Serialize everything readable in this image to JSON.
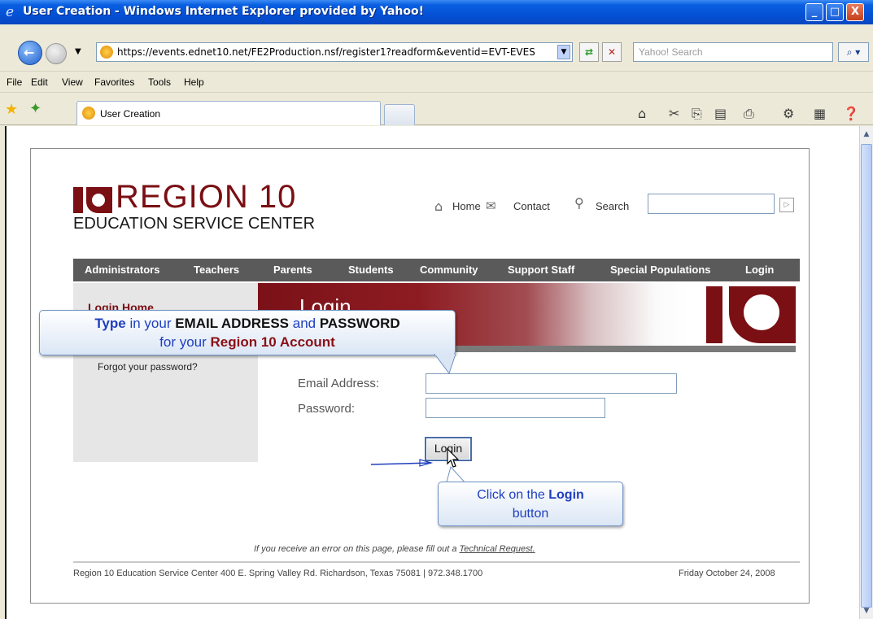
{
  "window": {
    "title": "User Creation - Windows Internet Explorer provided by Yahoo!",
    "minimize": "_",
    "maximize": "□",
    "close": "X"
  },
  "browser": {
    "url": "https://events.ednet10.net/FE2Production.nsf/register1?readform&eventid=EVT-EVES",
    "search_placeholder": "Yahoo! Search",
    "menu": [
      "File",
      "Edit",
      "View",
      "Favorites",
      "Tools",
      "Help"
    ],
    "tab_label": "User Creation",
    "icons": [
      "back-arrow-icon",
      "forward-arrow-icon",
      "refresh-icon",
      "stop-icon",
      "search-icon",
      "favorites-star-icon",
      "add-favorites-icon",
      "home-icon",
      "feeds-icon",
      "print-icon",
      "page-icon",
      "tools-icon",
      "help-icon"
    ]
  },
  "site": {
    "logo_text": "REGION 10",
    "logo_sub": "EDUCATION SERVICE CENTER",
    "top_links": {
      "home": "Home",
      "contact": "Contact",
      "search": "Search"
    },
    "nav": [
      "Administrators",
      "Teachers",
      "Parents",
      "Students",
      "Community",
      "Support Staff",
      "Special Populations",
      "Login"
    ],
    "sidebar_heading": "Login Home",
    "forgot": "Forgot your password?",
    "banner_title": "Login",
    "form": {
      "email_label": "Email Address:",
      "password_label": "Password:",
      "login_button": "Login"
    },
    "error_text": "If you receive an error on this page, please fill out a",
    "error_link": "Technical Request.",
    "footer_address": "Region 10 Education Service Center 400 E. Spring Valley Rd. Richardson, Texas 75081 | 972.348.1700",
    "footer_date": "Friday October 24, 2008"
  },
  "callouts": {
    "type": {
      "w1": "Type",
      "w2": " in your ",
      "w3": "EMAIL ADDRESS",
      "w4": " and ",
      "w5": "PASSWORD",
      "w6": "for your ",
      "w7": "Region 10 Account"
    },
    "click": {
      "w1": "Click on the ",
      "w2": "Login",
      "w3": "button"
    }
  },
  "colors": {
    "brand_red": "#7a0f14",
    "nav_gray": "#5a5a5a",
    "callout_blue": "#1f3fbf"
  }
}
